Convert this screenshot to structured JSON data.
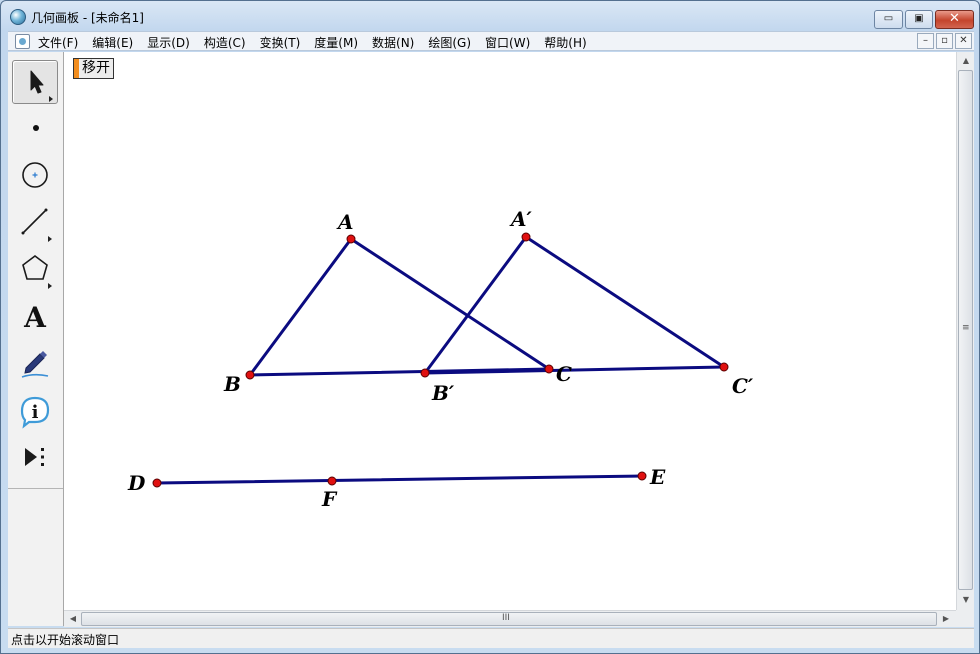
{
  "window": {
    "title": "几何画板 - [未命名1]"
  },
  "caption_buttons": {
    "minimize": "▭",
    "maximize": "▣",
    "close": "✕"
  },
  "menu": {
    "items": [
      "文件(F)",
      "编辑(E)",
      "显示(D)",
      "构造(C)",
      "变换(T)",
      "度量(M)",
      "数据(N)",
      "绘图(G)",
      "窗口(W)",
      "帮助(H)"
    ],
    "mdi_buttons": [
      "–",
      "▫",
      "✕"
    ]
  },
  "toolbox": {
    "tools": [
      {
        "name": "selection-arrow-tool",
        "icon": "arrow-icon",
        "selected": true
      },
      {
        "name": "point-tool",
        "icon": "point-icon",
        "selected": false
      },
      {
        "name": "compass-tool",
        "icon": "circle-icon",
        "selected": false
      },
      {
        "name": "straightedge-tool",
        "icon": "segment-icon",
        "selected": false
      },
      {
        "name": "polygon-tool",
        "icon": "pentagon-icon",
        "selected": false
      },
      {
        "name": "text-tool",
        "icon": "letter-a-icon",
        "selected": false
      },
      {
        "name": "marker-tool",
        "icon": "marker-icon",
        "selected": false
      },
      {
        "name": "information-tool",
        "icon": "info-icon",
        "selected": false
      },
      {
        "name": "custom-tool",
        "icon": "play-more-icon",
        "selected": false
      }
    ],
    "text_tool_glyph": "A",
    "info_tool_glyph": "i"
  },
  "canvas": {
    "move_button_label": "移开",
    "line_color": "#0b0b80",
    "point_color": "#e01010",
    "labels": {
      "A": "A",
      "B": "B",
      "C": "C",
      "A_prime": "A′",
      "B_prime": "B′",
      "C_prime": "C′",
      "D": "D",
      "E": "E",
      "F": "F"
    }
  },
  "scrollbars": {
    "grip": "≡",
    "hgrip": "III",
    "up": "▲",
    "down": "▼",
    "left": "◀",
    "right": "▶"
  },
  "status": {
    "text": "点击以开始滚动窗口"
  }
}
